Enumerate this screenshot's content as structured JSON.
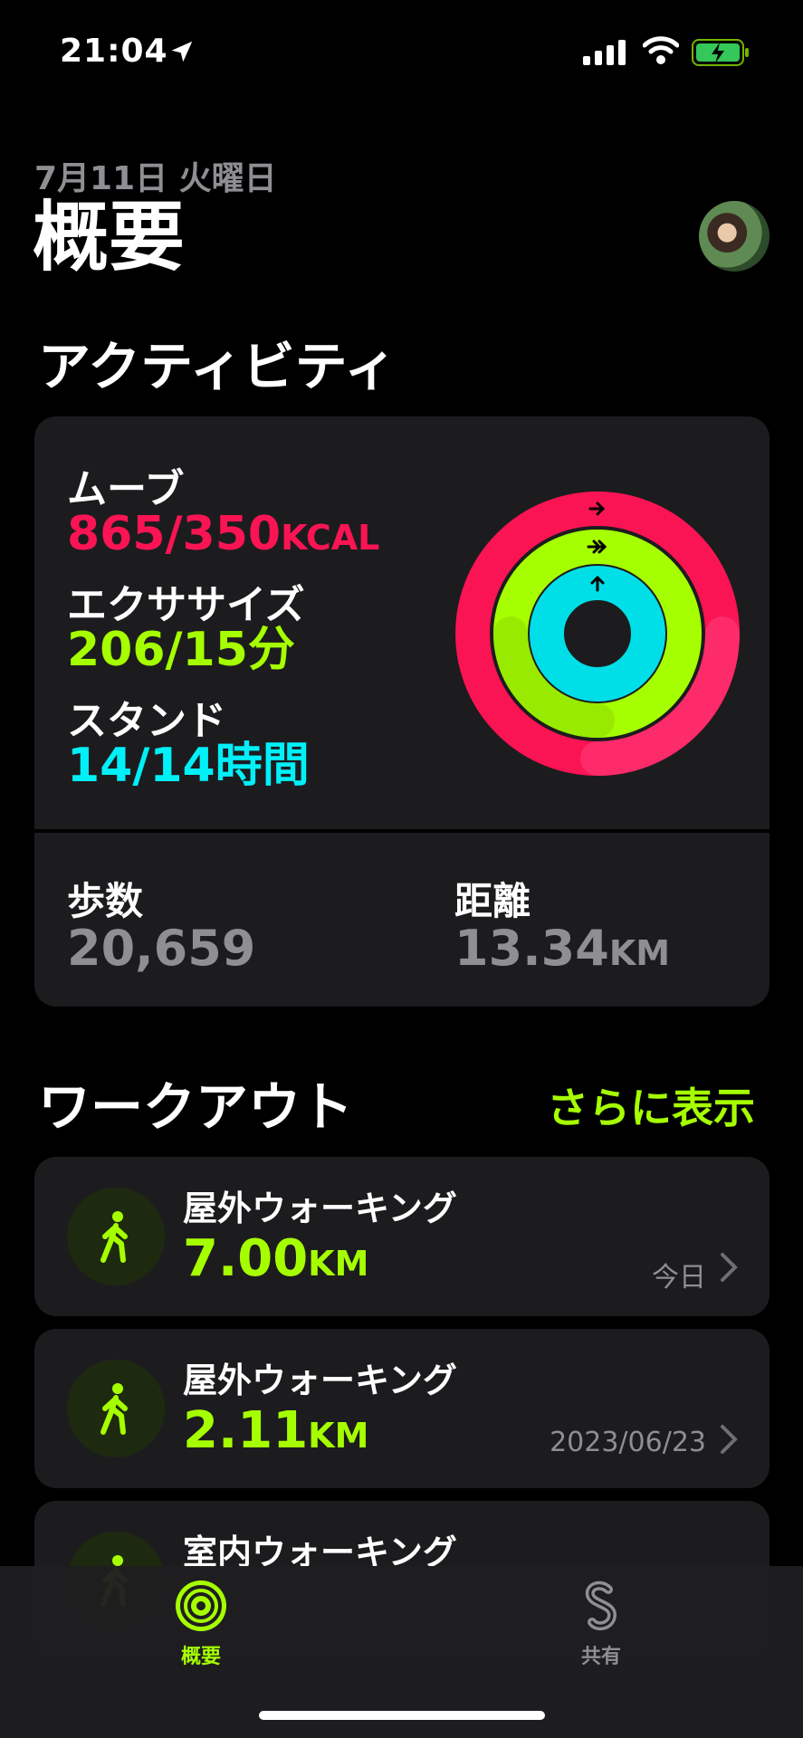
{
  "status_bar": {
    "time": "21:04"
  },
  "header": {
    "date": "7月11日 火曜日",
    "title": "概要"
  },
  "activity": {
    "section_title": "アクティビティ",
    "move": {
      "label": "ムーブ",
      "value": "865/350",
      "unit": "KCAL",
      "color": "#fa1454",
      "progress": 2.47
    },
    "exercise": {
      "label": "エクササイズ",
      "value": "206/15",
      "unit": "分",
      "color": "#a6ff00",
      "progress": 13.7
    },
    "stand": {
      "label": "スタンド",
      "value": "14/14",
      "unit": "時間",
      "color": "#00f0f8",
      "progress": 1.0
    },
    "steps": {
      "label": "歩数",
      "value": "20,659"
    },
    "distance": {
      "label": "距離",
      "value": "13.34",
      "unit": "KM"
    }
  },
  "workouts": {
    "section_title": "ワークアウト",
    "show_more": "さらに表示",
    "items": [
      {
        "name": "屋外ウォーキング",
        "distance": "7.00",
        "unit": "KM",
        "date": "今日"
      },
      {
        "name": "屋外ウォーキング",
        "distance": "2.11",
        "unit": "KM",
        "date": "2023/06/23"
      },
      {
        "name": "室内ウォーキング",
        "distance": "",
        "unit": "",
        "date": ""
      }
    ]
  },
  "tabbar": {
    "tabs": [
      {
        "label": "概要",
        "icon": "summary-rings-icon",
        "selected": true
      },
      {
        "label": "共有",
        "icon": "sharing-icon",
        "selected": false
      }
    ]
  },
  "colors": {
    "accent": "#a6ff00",
    "card": "#1c1c1e",
    "secondary_text": "#8e8e93"
  }
}
